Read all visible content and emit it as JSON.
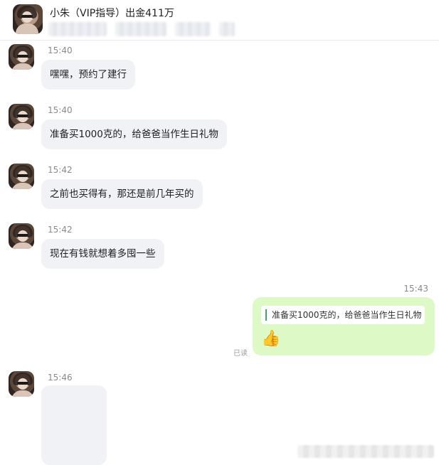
{
  "header": {
    "title": "小朱（VIP指导）出金411万"
  },
  "messages": [
    {
      "time": "15:40",
      "text": "嘿嘿，预约了建行"
    },
    {
      "time": "15:40",
      "text": "准备买1000克的，给爸爸当作生日礼物"
    },
    {
      "time": "15:42",
      "text": "之前也买得有，那还是前几年买的"
    },
    {
      "time": "15:42",
      "text": "现在有钱就想着多囤一些"
    }
  ],
  "my_message": {
    "time": "15:43",
    "quote": "准备买1000克的，给爸爸当作生日礼物",
    "emoji": "👍",
    "read_status": "已读"
  },
  "last_message": {
    "time": "15:46"
  },
  "colors": {
    "incoming_bubble": "#f1f2f6",
    "outgoing_bubble": "#dcf9c6",
    "quote_bar": "#39a86b"
  }
}
